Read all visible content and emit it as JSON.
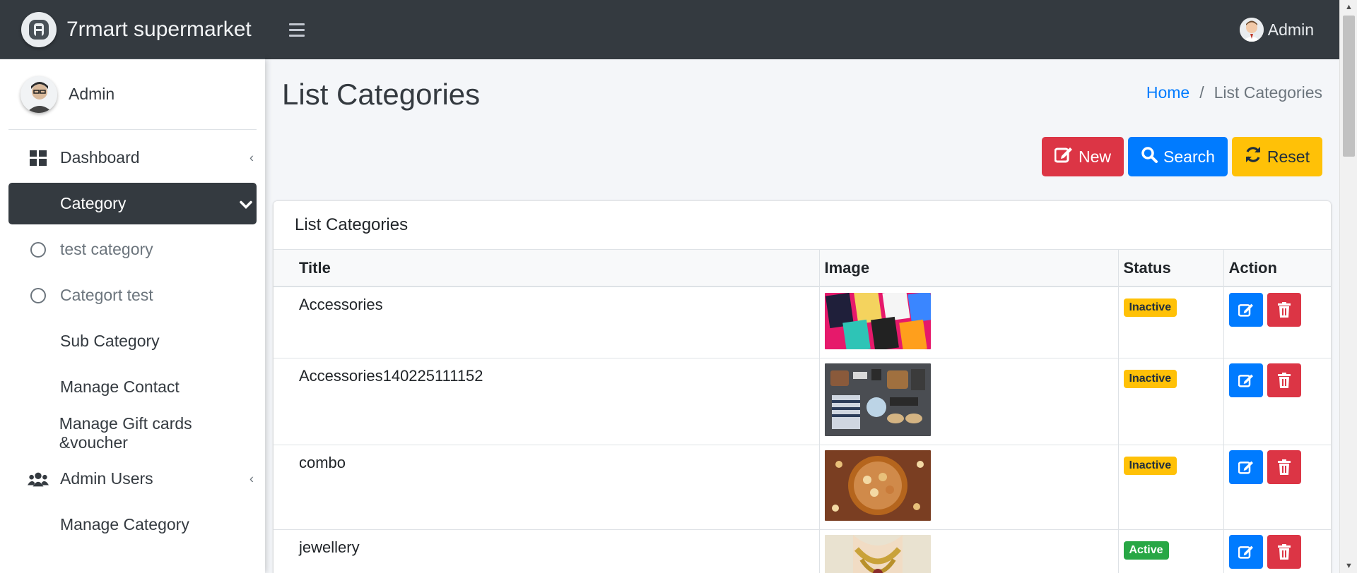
{
  "brand": {
    "name": "7rmart supermarket"
  },
  "topbar": {
    "user_name": "Admin"
  },
  "sidebar": {
    "user_name": "Admin",
    "items": [
      {
        "label": "Dashboard",
        "icon": "dashboard-icon"
      },
      {
        "label": "Category",
        "icon": "",
        "active": true
      },
      {
        "label": "test category",
        "icon": "circle-icon"
      },
      {
        "label": "Categort test",
        "icon": "circle-icon"
      },
      {
        "label": "Sub Category",
        "icon": ""
      },
      {
        "label": "Manage Contact",
        "icon": ""
      },
      {
        "label": "Manage Gift cards &voucher",
        "icon": ""
      },
      {
        "label": "Admin Users",
        "icon": "users-icon"
      },
      {
        "label": "Manage Category",
        "icon": ""
      }
    ]
  },
  "page": {
    "title": "List Categories"
  },
  "breadcrumb": {
    "home": "Home",
    "separator": "/",
    "current": "List Categories"
  },
  "actions": {
    "new_label": "New",
    "search_label": "Search",
    "reset_label": "Reset"
  },
  "card": {
    "title": "List Categories",
    "columns": [
      "Title",
      "Image",
      "Status",
      "Action"
    ],
    "rows": [
      {
        "title": "Accessories",
        "status": "Inactive"
      },
      {
        "title": "Accessories140225111152",
        "status": "Inactive"
      },
      {
        "title": "combo",
        "status": "Inactive"
      },
      {
        "title": "jewellery",
        "status": "Active"
      }
    ]
  },
  "colors": {
    "navbar": "#343a40",
    "primary": "#007bff",
    "danger": "#dc3545",
    "warning": "#ffc107",
    "success": "#28a745"
  }
}
